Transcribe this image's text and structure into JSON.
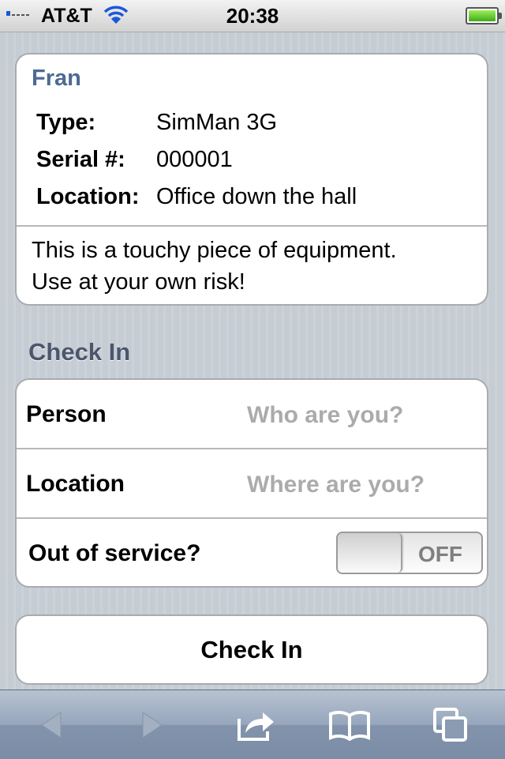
{
  "status_bar": {
    "carrier": "AT&T",
    "time": "20:38"
  },
  "equipment": {
    "name": "Fran",
    "specs": [
      {
        "label": "Type:",
        "value": "SimMan 3G"
      },
      {
        "label": "Serial #:",
        "value": "000001"
      },
      {
        "label": "Location:",
        "value": "Office down the hall"
      }
    ],
    "note_line1": "This is a touchy piece of equipment.",
    "note_line2": "Use at your own risk!"
  },
  "check_in": {
    "section_title": "Check In",
    "person_label": "Person",
    "person_placeholder": "Who are you?",
    "location_label": "Location",
    "location_placeholder": "Where are you?",
    "out_of_service_label": "Out of service?",
    "toggle_state": "OFF",
    "submit_label": "Check In"
  },
  "toolbar": {
    "icons": [
      "back-arrow-icon",
      "forward-arrow-icon",
      "share-icon",
      "bookmarks-icon",
      "pages-icon"
    ]
  },
  "colors": {
    "accent_title": "#4d6a94",
    "placeholder": "#ababab",
    "background": "#c5ccd4"
  }
}
